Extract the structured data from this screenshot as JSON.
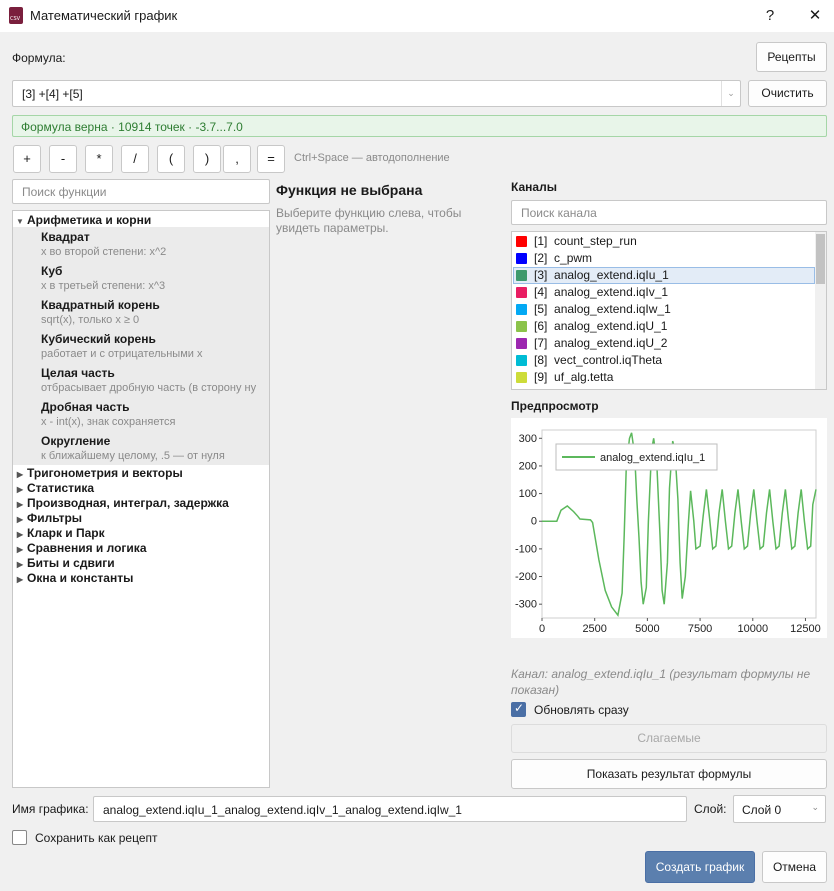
{
  "window": {
    "title": "Математический график",
    "help": "?",
    "close": "✕",
    "icon_text": "CSV"
  },
  "formula": {
    "label": "Формула:",
    "recipes_button": "Рецепты",
    "value": "[3] +[4] +[5]",
    "clear_button": "Очистить",
    "status": "Формула верна · 10914 точек · -3.7...7.0",
    "status_color": "#2e7d32"
  },
  "operators": [
    "+",
    "-",
    "*",
    "/",
    "(",
    ")",
    ",",
    "="
  ],
  "autocomplete_hint": "Ctrl+Space — автодополнение",
  "function_search": {
    "placeholder": "Поиск функции"
  },
  "categories": {
    "expanded": {
      "label": "Арифметика и корни",
      "functions": [
        {
          "name": "Квадрат",
          "desc": "x во второй степени: x^2"
        },
        {
          "name": "Куб",
          "desc": "x в третьей степени: x^3"
        },
        {
          "name": "Квадратный корень",
          "desc": "sqrt(x), только x ≥ 0"
        },
        {
          "name": "Кубический корень",
          "desc": "работает и с отрицательными x"
        },
        {
          "name": "Целая часть",
          "desc": "отбрасывает дробную часть (в сторону ну"
        },
        {
          "name": "Дробная часть",
          "desc": "x - int(x), знак сохраняется"
        },
        {
          "name": "Округление",
          "desc": "к ближайшему целому, .5 — от нуля"
        }
      ]
    },
    "collapsed": [
      "Тригонометрия и векторы",
      "Статистика",
      "Производная, интеграл, задержка",
      "Фильтры",
      "Кларк и Парк",
      "Сравнения и логика",
      "Биты и сдвиги",
      "Окна и константы"
    ]
  },
  "function_panel": {
    "title": "Функция не выбрана",
    "hint": "Выберите функцию слева, чтобы увидеть параметры."
  },
  "channels": {
    "title": "Каналы",
    "search_placeholder": "Поиск канала",
    "items": [
      {
        "id": "[1]",
        "name": "count_step_run",
        "color": "#ff0000"
      },
      {
        "id": "[2]",
        "name": "c_pwm",
        "color": "#0000ff"
      },
      {
        "id": "[3]",
        "name": "analog_extend.iqIu_1",
        "color": "#3e9a6e",
        "selected": true
      },
      {
        "id": "[4]",
        "name": "analog_extend.iqIv_1",
        "color": "#e91e63"
      },
      {
        "id": "[5]",
        "name": "analog_extend.iqIw_1",
        "color": "#03a9f4"
      },
      {
        "id": "[6]",
        "name": "analog_extend.iqU_1",
        "color": "#8bc34a"
      },
      {
        "id": "[7]",
        "name": "analog_extend.iqU_2",
        "color": "#9c27b0"
      },
      {
        "id": "[8]",
        "name": "vect_control.iqTheta",
        "color": "#00bcd4"
      },
      {
        "id": "[9]",
        "name": "uf_alg.tetta",
        "color": "#cddc39"
      }
    ]
  },
  "preview": {
    "title": "Предпросмотр",
    "note": "Канал: analog_extend.iqIu_1 (результат формулы не показан)"
  },
  "chart_data": {
    "type": "line",
    "series": [
      {
        "name": "analog_extend.iqIu_1",
        "color": "#5cb85c"
      }
    ],
    "x_ticks": [
      0,
      2500,
      5000,
      7500,
      10000,
      12500
    ],
    "y_ticks": [
      300,
      200,
      100,
      0,
      -100,
      -200,
      -300
    ],
    "xlim": [
      0,
      13000
    ],
    "ylim": [
      -350,
      330
    ],
    "points": [
      [
        0,
        0
      ],
      [
        700,
        0
      ],
      [
        900,
        40
      ],
      [
        1200,
        55
      ],
      [
        1500,
        35
      ],
      [
        1700,
        18
      ],
      [
        1800,
        8
      ],
      [
        2300,
        5
      ],
      [
        2400,
        -5
      ],
      [
        2700,
        -140
      ],
      [
        3000,
        -250
      ],
      [
        3300,
        -310
      ],
      [
        3600,
        -340
      ],
      [
        3800,
        -260
      ],
      [
        3900,
        -50
      ],
      [
        4000,
        200
      ],
      [
        4150,
        300
      ],
      [
        4250,
        320
      ],
      [
        4400,
        240
      ],
      [
        4500,
        80
      ],
      [
        4600,
        -60
      ],
      [
        4700,
        -220
      ],
      [
        4800,
        -300
      ],
      [
        4950,
        -240
      ],
      [
        5050,
        0
      ],
      [
        5200,
        260
      ],
      [
        5300,
        300
      ],
      [
        5450,
        200
      ],
      [
        5600,
        -50
      ],
      [
        5700,
        -250
      ],
      [
        5800,
        -300
      ],
      [
        5950,
        -150
      ],
      [
        6050,
        120
      ],
      [
        6200,
        290
      ],
      [
        6300,
        260
      ],
      [
        6450,
        80
      ],
      [
        6550,
        -150
      ],
      [
        6650,
        -280
      ],
      [
        6800,
        -200
      ],
      [
        6950,
        0
      ],
      [
        7050,
        110
      ],
      [
        7200,
        0
      ],
      [
        7300,
        -100
      ],
      [
        7500,
        -90
      ],
      [
        7650,
        20
      ],
      [
        7800,
        115
      ],
      [
        7950,
        10
      ],
      [
        8100,
        -100
      ],
      [
        8250,
        -90
      ],
      [
        8400,
        30
      ],
      [
        8550,
        115
      ],
      [
        8700,
        0
      ],
      [
        8850,
        -100
      ],
      [
        9000,
        -90
      ],
      [
        9150,
        30
      ],
      [
        9300,
        115
      ],
      [
        9450,
        0
      ],
      [
        9600,
        -100
      ],
      [
        9750,
        -90
      ],
      [
        9900,
        30
      ],
      [
        10050,
        115
      ],
      [
        10200,
        0
      ],
      [
        10350,
        -100
      ],
      [
        10500,
        -90
      ],
      [
        10650,
        30
      ],
      [
        10800,
        115
      ],
      [
        10950,
        0
      ],
      [
        11100,
        -100
      ],
      [
        11250,
        -90
      ],
      [
        11400,
        30
      ],
      [
        11550,
        115
      ],
      [
        11700,
        0
      ],
      [
        11850,
        -100
      ],
      [
        12000,
        -90
      ],
      [
        12150,
        30
      ],
      [
        12300,
        115
      ],
      [
        12450,
        0
      ],
      [
        12600,
        -100
      ],
      [
        12750,
        -90
      ],
      [
        12850,
        60
      ],
      [
        13000,
        115
      ]
    ]
  },
  "update_now": {
    "label": "Обновлять сразу",
    "checked": true
  },
  "addends_button": "Слагаемые",
  "show_result_button": "Показать результат формулы",
  "plot_name": {
    "label": "Имя графика:",
    "value": "analog_extend.iqIu_1_analog_extend.iqIv_1_analog_extend.iqIw_1"
  },
  "layer": {
    "label": "Слой:",
    "value": "Слой 0"
  },
  "save_recipe": {
    "label": "Сохранить как рецепт",
    "checked": false
  },
  "create_button": "Создать график",
  "cancel_button": "Отмена"
}
